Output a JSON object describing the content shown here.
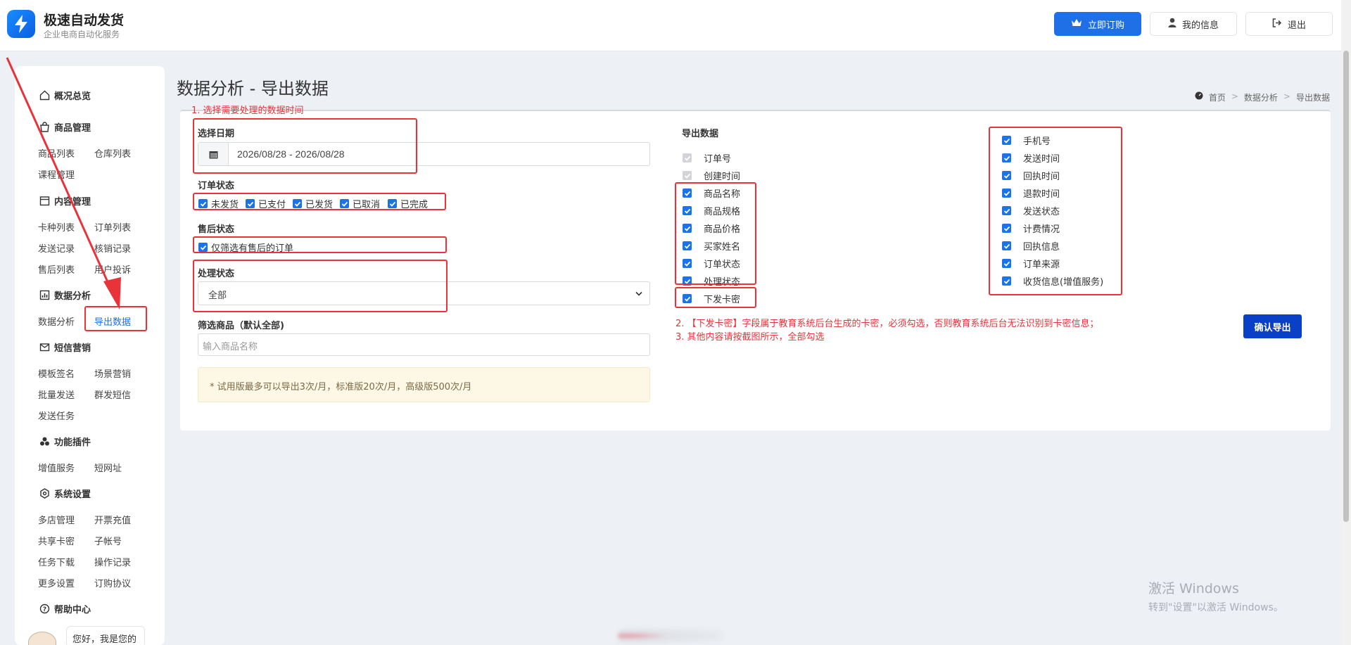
{
  "header": {
    "brand_title": "极速自动发货",
    "brand_sub": "企业电商自动化服务",
    "subscribe": "立即订购",
    "my_info": "我的信息",
    "logout": "退出"
  },
  "sidebar": {
    "overview": "概况总览",
    "goods_mgmt": "商品管理",
    "goods_list": "商品列表",
    "warehouse_list": "仓库列表",
    "course_mgmt": "课程管理",
    "content_mgmt": "内容管理",
    "card_list": "卡种列表",
    "order_list": "订单列表",
    "send_record": "发送记录",
    "writeoff_record": "核销记录",
    "aftersale_list": "售后列表",
    "user_complaint": "用户投诉",
    "data_analysis": "数据分析",
    "data_analysis_item": "数据分析",
    "export_data": "导出数据",
    "sms_marketing": "短信营销",
    "template_sign": "模板签名",
    "scene_marketing": "场景营销",
    "batch_send": "批量发送",
    "group_sms": "群发短信",
    "send_task": "发送任务",
    "plugins": "功能插件",
    "value_added": "增值服务",
    "short_url": "短网址",
    "system_settings": "系统设置",
    "multi_store": "多店管理",
    "invoice_recharge": "开票充值",
    "shared_card": "共享卡密",
    "sub_account": "子帐号",
    "task_download": "任务下载",
    "operation_log": "操作记录",
    "more_settings": "更多设置",
    "order_agreement": "订购协议",
    "help_center": "帮助中心",
    "chat_text": "您好，我是您的"
  },
  "page": {
    "title": "数据分析 - 导出数据",
    "breadcrumb": [
      "首页",
      "数据分析",
      "导出数据"
    ]
  },
  "annotations": {
    "a1": "1. 选择需要处理的数据时间",
    "a2": "2. 【下发卡密】字段属于教育系统后台生成的卡密，必须勾选，否则教育系统后台无法识别到卡密信息；",
    "a3": "3. 其他内容请按截图所示，全部勾选"
  },
  "form": {
    "date_label": "选择日期",
    "date_value": "2026/08/28 - 2026/08/28",
    "order_status_label": "订单状态",
    "order_status": [
      "未发货",
      "已支付",
      "已发货",
      "已取消",
      "已完成"
    ],
    "aftersale_label": "售后状态",
    "aftersale_option": "仅筛选有售后的订单",
    "process_label": "处理状态",
    "process_value": "全部",
    "goods_label": "筛选商品（默认全部)",
    "goods_placeholder": "输入商品名称",
    "notice": "* 试用版最多可以导出3次/月，标准版20次/月，高级版500次/月"
  },
  "export": {
    "label": "导出数据",
    "col1": [
      "订单号",
      "创建时间",
      "商品名称",
      "商品规格",
      "商品价格",
      "买家姓名",
      "订单状态",
      "处理状态",
      "下发卡密"
    ],
    "col2": [
      "手机号",
      "发送时间",
      "回执时间",
      "退款时间",
      "发送状态",
      "计费情况",
      "回执信息",
      "订单来源",
      "收货信息(增值服务)"
    ],
    "confirm": "确认导出"
  },
  "watermark": {
    "line1": "激活 Windows",
    "line2": "转到\"设置\"以激活 Windows。"
  }
}
